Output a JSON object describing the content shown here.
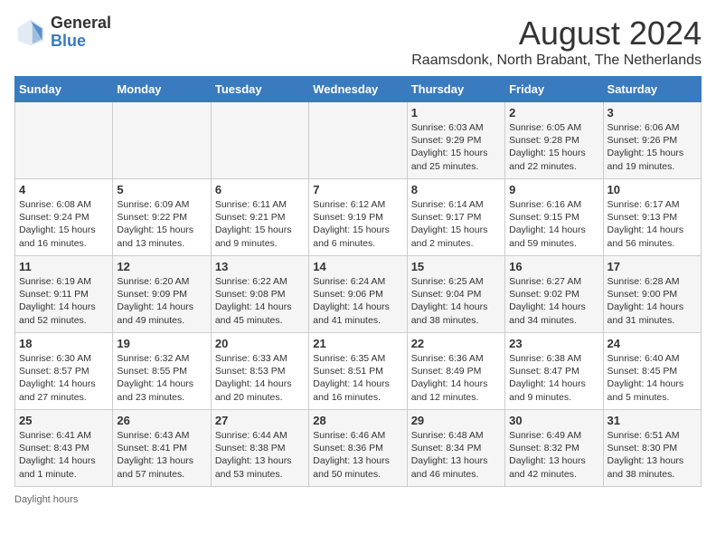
{
  "logo": {
    "general": "General",
    "blue": "Blue"
  },
  "title": "August 2024",
  "subtitle": "Raamsdonk, North Brabant, The Netherlands",
  "days_of_week": [
    "Sunday",
    "Monday",
    "Tuesday",
    "Wednesday",
    "Thursday",
    "Friday",
    "Saturday"
  ],
  "footer": "Daylight hours",
  "weeks": [
    [
      {
        "day": "",
        "info": ""
      },
      {
        "day": "",
        "info": ""
      },
      {
        "day": "",
        "info": ""
      },
      {
        "day": "",
        "info": ""
      },
      {
        "day": "1",
        "info": "Sunrise: 6:03 AM\nSunset: 9:29 PM\nDaylight: 15 hours\nand 25 minutes."
      },
      {
        "day": "2",
        "info": "Sunrise: 6:05 AM\nSunset: 9:28 PM\nDaylight: 15 hours\nand 22 minutes."
      },
      {
        "day": "3",
        "info": "Sunrise: 6:06 AM\nSunset: 9:26 PM\nDaylight: 15 hours\nand 19 minutes."
      }
    ],
    [
      {
        "day": "4",
        "info": "Sunrise: 6:08 AM\nSunset: 9:24 PM\nDaylight: 15 hours\nand 16 minutes."
      },
      {
        "day": "5",
        "info": "Sunrise: 6:09 AM\nSunset: 9:22 PM\nDaylight: 15 hours\nand 13 minutes."
      },
      {
        "day": "6",
        "info": "Sunrise: 6:11 AM\nSunset: 9:21 PM\nDaylight: 15 hours\nand 9 minutes."
      },
      {
        "day": "7",
        "info": "Sunrise: 6:12 AM\nSunset: 9:19 PM\nDaylight: 15 hours\nand 6 minutes."
      },
      {
        "day": "8",
        "info": "Sunrise: 6:14 AM\nSunset: 9:17 PM\nDaylight: 15 hours\nand 2 minutes."
      },
      {
        "day": "9",
        "info": "Sunrise: 6:16 AM\nSunset: 9:15 PM\nDaylight: 14 hours\nand 59 minutes."
      },
      {
        "day": "10",
        "info": "Sunrise: 6:17 AM\nSunset: 9:13 PM\nDaylight: 14 hours\nand 56 minutes."
      }
    ],
    [
      {
        "day": "11",
        "info": "Sunrise: 6:19 AM\nSunset: 9:11 PM\nDaylight: 14 hours\nand 52 minutes."
      },
      {
        "day": "12",
        "info": "Sunrise: 6:20 AM\nSunset: 9:09 PM\nDaylight: 14 hours\nand 49 minutes."
      },
      {
        "day": "13",
        "info": "Sunrise: 6:22 AM\nSunset: 9:08 PM\nDaylight: 14 hours\nand 45 minutes."
      },
      {
        "day": "14",
        "info": "Sunrise: 6:24 AM\nSunset: 9:06 PM\nDaylight: 14 hours\nand 41 minutes."
      },
      {
        "day": "15",
        "info": "Sunrise: 6:25 AM\nSunset: 9:04 PM\nDaylight: 14 hours\nand 38 minutes."
      },
      {
        "day": "16",
        "info": "Sunrise: 6:27 AM\nSunset: 9:02 PM\nDaylight: 14 hours\nand 34 minutes."
      },
      {
        "day": "17",
        "info": "Sunrise: 6:28 AM\nSunset: 9:00 PM\nDaylight: 14 hours\nand 31 minutes."
      }
    ],
    [
      {
        "day": "18",
        "info": "Sunrise: 6:30 AM\nSunset: 8:57 PM\nDaylight: 14 hours\nand 27 minutes."
      },
      {
        "day": "19",
        "info": "Sunrise: 6:32 AM\nSunset: 8:55 PM\nDaylight: 14 hours\nand 23 minutes."
      },
      {
        "day": "20",
        "info": "Sunrise: 6:33 AM\nSunset: 8:53 PM\nDaylight: 14 hours\nand 20 minutes."
      },
      {
        "day": "21",
        "info": "Sunrise: 6:35 AM\nSunset: 8:51 PM\nDaylight: 14 hours\nand 16 minutes."
      },
      {
        "day": "22",
        "info": "Sunrise: 6:36 AM\nSunset: 8:49 PM\nDaylight: 14 hours\nand 12 minutes."
      },
      {
        "day": "23",
        "info": "Sunrise: 6:38 AM\nSunset: 8:47 PM\nDaylight: 14 hours\nand 9 minutes."
      },
      {
        "day": "24",
        "info": "Sunrise: 6:40 AM\nSunset: 8:45 PM\nDaylight: 14 hours\nand 5 minutes."
      }
    ],
    [
      {
        "day": "25",
        "info": "Sunrise: 6:41 AM\nSunset: 8:43 PM\nDaylight: 14 hours\nand 1 minute."
      },
      {
        "day": "26",
        "info": "Sunrise: 6:43 AM\nSunset: 8:41 PM\nDaylight: 13 hours\nand 57 minutes."
      },
      {
        "day": "27",
        "info": "Sunrise: 6:44 AM\nSunset: 8:38 PM\nDaylight: 13 hours\nand 53 minutes."
      },
      {
        "day": "28",
        "info": "Sunrise: 6:46 AM\nSunset: 8:36 PM\nDaylight: 13 hours\nand 50 minutes."
      },
      {
        "day": "29",
        "info": "Sunrise: 6:48 AM\nSunset: 8:34 PM\nDaylight: 13 hours\nand 46 minutes."
      },
      {
        "day": "30",
        "info": "Sunrise: 6:49 AM\nSunset: 8:32 PM\nDaylight: 13 hours\nand 42 minutes."
      },
      {
        "day": "31",
        "info": "Sunrise: 6:51 AM\nSunset: 8:30 PM\nDaylight: 13 hours\nand 38 minutes."
      }
    ]
  ]
}
